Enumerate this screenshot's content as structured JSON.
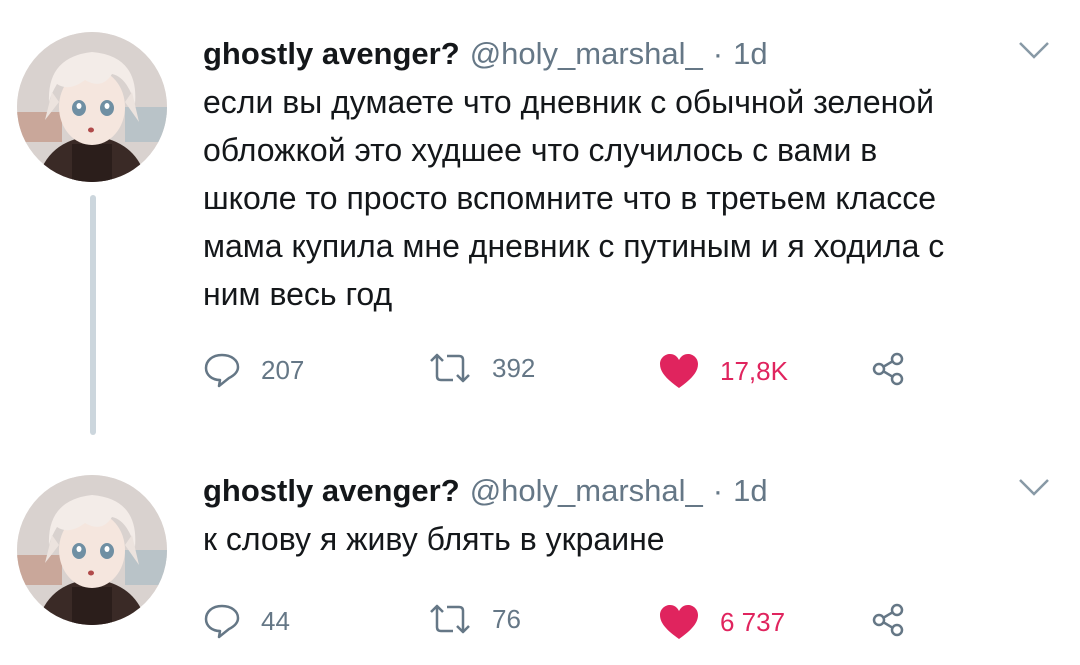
{
  "tweets": [
    {
      "name": "ghostly avenger?",
      "handle": "@holy_marshal_",
      "dot": "·",
      "time": "1d",
      "lines": [
        "если вы думаете что дневник с обычной зеленой",
        "обложкой это худшее что случилось с вами в",
        "школе то просто вспомните что в третьем классе",
        "мама купила мне дневник с путиным и я ходила с",
        "ним весь год"
      ],
      "replies": "207",
      "retweets": "392",
      "likes": "17,8K"
    },
    {
      "name": "ghostly avenger?",
      "handle": "@holy_marshal_",
      "dot": "·",
      "time": "1d",
      "lines": [
        "к слову я живу блять в украине"
      ],
      "replies": "44",
      "retweets": "76",
      "likes": "6 737"
    }
  ],
  "colors": {
    "like": "#e0245e",
    "muted": "#657786",
    "thread_line": "#ccd6dd"
  },
  "icons": [
    "reply-icon",
    "retweet-icon",
    "heart-icon",
    "share-icon",
    "chevron-down-icon"
  ]
}
